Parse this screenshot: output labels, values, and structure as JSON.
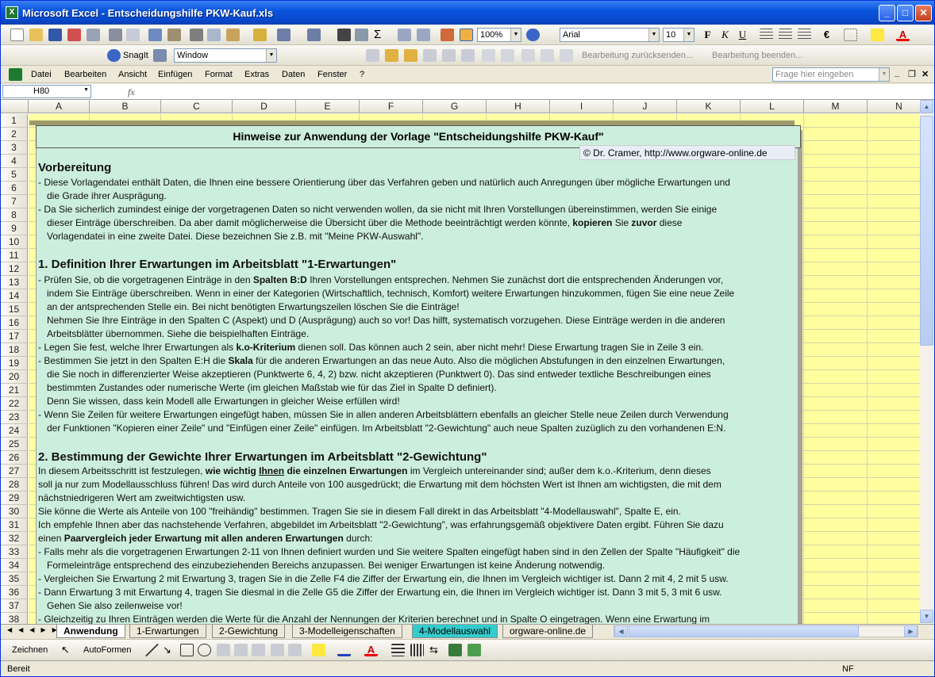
{
  "window": {
    "title": "Microsoft Excel - Entscheidungshilfe PKW-Kauf.xls"
  },
  "toolbar": {
    "zoom": "100%",
    "font": "Arial",
    "size": "10"
  },
  "snagit": {
    "label": "SnagIt",
    "window_value": "Window"
  },
  "review": {
    "send": "Bearbeitung zurücksenden...",
    "end": "Bearbeitung beenden..."
  },
  "menu": [
    "Datei",
    "Bearbeiten",
    "Ansicht",
    "Einfügen",
    "Format",
    "Extras",
    "Daten",
    "Fenster",
    "?"
  ],
  "help_placeholder": "Frage hier eingeben",
  "namebox": "H80",
  "fx": "fx",
  "columns": [
    "A",
    "B",
    "C",
    "D",
    "E",
    "F",
    "G",
    "H",
    "I",
    "J",
    "K",
    "L",
    "M",
    "N"
  ],
  "rows": [
    "1",
    "2",
    "3",
    "4",
    "5",
    "6",
    "7",
    "8",
    "9",
    "10",
    "11",
    "12",
    "13",
    "14",
    "15",
    "16",
    "17",
    "18",
    "19",
    "20",
    "21",
    "22",
    "23",
    "24",
    "25",
    "26",
    "27",
    "28",
    "29",
    "30",
    "31",
    "32",
    "33",
    "34",
    "35",
    "36",
    "37",
    "38"
  ],
  "doc": {
    "title": "Hinweise zur Anwendung der Vorlage \"Entscheidungshilfe PKW-Kauf\"",
    "copyright": "© Dr. Cramer, http://www.orgware-online.de",
    "h1": "Vorbereitung",
    "h2": "1. Definition Ihrer Erwartungen im Arbeitsblatt \"1-Erwartungen\"",
    "h3": "2. Bestimmung der Gewichte Ihrer Erwartungen im Arbeitsblatt \"2-Gewichtung\"",
    "l6": "- Diese Vorlagendatei enthält Daten, die Ihnen eine bessere Orientierung über das Verfahren geben und natürlich auch Anregungen über mögliche Erwartungen und",
    "l7": "die Grade ihrer Ausprägung.",
    "l8": "- Da Sie sicherlich zumindest einige der vorgetragenen Daten so nicht verwenden wollen, da sie nicht mit Ihren Vorstellungen übereinstimmen, werden Sie einige",
    "l9a": "dieser Einträge überschreiben. Da aber damit möglicherweise die Übersicht über die Methode beeinträchtigt werden könnte, ",
    "l9b": "kopieren",
    "l9c": " Sie ",
    "l9d": "zuvor",
    "l9e": " diese",
    "l10": "Vorlagendatei in eine zweite Datei. Diese bezeichnen Sie z.B. mit \"Meine PKW-Auswahl\".",
    "l13a": "- Prüfen Sie, ob die vorgetragenen Einträge in den ",
    "l13b": "Spalten B:D",
    "l13c": " Ihren Vorstellungen entsprechen. Nehmen Sie zunächst dort die entsprechenden Änderungen vor,",
    "l14": "indem Sie Einträge überschreiben. Wenn in einer der Kategorien (Wirtschaftlich, technisch, Komfort) weitere Erwartungen hinzukommen, fügen Sie eine neue Zeile",
    "l15": "an der antsprechenden Stelle ein. Bei nicht benötigten Erwartungszeilen löschen Sie die Einträge!",
    "l16": "Nehmen Sie Ihre Einträge in den Spalten C (Aspekt) und D (Ausprägung) auch so vor! Das hilft, systematisch vorzugehen. Diese Einträge werden in die anderen",
    "l17": "Arbeitsblätter übernommen. Siehe die beispielhaften Einträge.",
    "l18a": "- Legen Sie fest, welche Ihrer Erwartungen als ",
    "l18b": "k.o-Kriterium",
    "l18c": " dienen soll. Das können auch 2 sein, aber nicht mehr! Diese Erwartung tragen Sie in Zeile 3 ein.",
    "l19a": "- Bestimmen Sie jetzt in den Spalten E:H die ",
    "l19b": "Skala",
    "l19c": " für die anderen Erwartungen an das neue Auto. Also die möglichen Abstufungen in den einzelnen Erwartungen,",
    "l20": "die Sie noch in differenzierter Weise akzeptieren (Punktwerte 6, 4, 2) bzw. nicht akzeptieren (Punktwert 0). Das sind entweder textliche Beschreibungen eines",
    "l21": "bestimmten Zustandes oder numerische Werte (im gleichen Maßstab wie für das Ziel in Spalte D definiert).",
    "l22": "Denn Sie wissen, dass kein Modell alle Erwartungen in gleicher Weise erfüllen wird!",
    "l23": "- Wenn Sie Zeilen für weitere Erwartungen eingefügt haben, müssen Sie in allen anderen Arbeitsblättern ebenfalls an gleicher Stelle neue Zeilen durch Verwendung",
    "l24": "der Funktionen \"Kopieren einer Zeile\" und \"Einfügen einer Zeile\" einfügen. Im Arbeitsblatt \"2-Gewichtung\" auch neue Spalten zuzüglich zu den vorhandenen E:N.",
    "l27a": "In diesem Arbeitsschritt ist festzulegen, ",
    "l27b": "wie wichtig ",
    "l27c": "Ihnen",
    "l27d": " die einzelnen Erwartungen",
    "l27e": " im Vergleich untereinander sind; außer dem k.o.-Kriterium, denn dieses",
    "l28": "soll ja nur zum Modellausschluss führen! Das wird durch Anteile von 100 ausgedrückt; die Erwartung mit dem höchsten Wert ist Ihnen am wichtigsten, die mit dem",
    "l29": "nächstniedrigeren Wert am zweitwichtigsten usw.",
    "l30": "Sie könne die Werte als Anteile von 100 \"freihändig\" bestimmen. Tragen Sie sie in diesem Fall direkt in das Arbeitsblatt \"4-Modellauswahl\", Spalte E, ein.",
    "l31": "Ich empfehle Ihnen aber das nachstehende Verfahren, abgebildet im Arbeitsblatt \"2-Gewichtung\", was erfahrungsgemäß objektivere Daten ergibt. Führen Sie dazu",
    "l32a": "einen ",
    "l32b": "Paarvergleich jeder Erwartung mit allen anderen Erwartungen",
    "l32c": " durch:",
    "l33": "- Falls mehr als die vorgetragenen Erwartungen 2-11 von Ihnen definiert wurden und Sie weitere Spalten eingefügt haben sind in den Zellen der Spalte \"Häufigkeit\" die",
    "l34": "Formeleinträge entsprechend des einzubeziehenden Bereichs anzupassen. Bei weniger Erwartungen ist keine Änderung notwendig.",
    "l35": "- Vergleichen Sie Erwartung 2 mit Erwartung 3, tragen Sie in die Zelle F4 die Ziffer der Erwartung ein, die Ihnen im Vergleich wichtiger ist. Dann 2 mit 4, 2 mit 5 usw.",
    "l36": "- Dann Erwartung 3 mit Erwartung 4, tragen Sie diesmal in die Zelle G5 die Ziffer der Erwartung ein, die Ihnen im Vergleich wichtiger ist. Dann 3 mit 5, 3 mit 6 usw.",
    "l37": "Gehen Sie also zeilenweise vor!",
    "l38": "- Gleichzeitig zu Ihren Einträgen werden die Werte für die Anzahl der Nennungen der Kriterien berechnet und in Spalte O eingetragen. Wenn eine Erwartung im"
  },
  "tabs": [
    "Anwendung",
    "1-Erwartungen",
    "2-Gewichtung",
    "3-Modelleigenschaften",
    "4-Modellauswahl",
    "orgware-online.de"
  ],
  "drawing": {
    "zeichnen": "Zeichnen",
    "autoformen": "AutoFormen"
  },
  "status": {
    "ready": "Bereit",
    "nf": "NF"
  },
  "colors": {
    "panel": "#CCEEDD",
    "sheet_bg": "#FFFFA0",
    "tab4": "#33CCCC"
  }
}
